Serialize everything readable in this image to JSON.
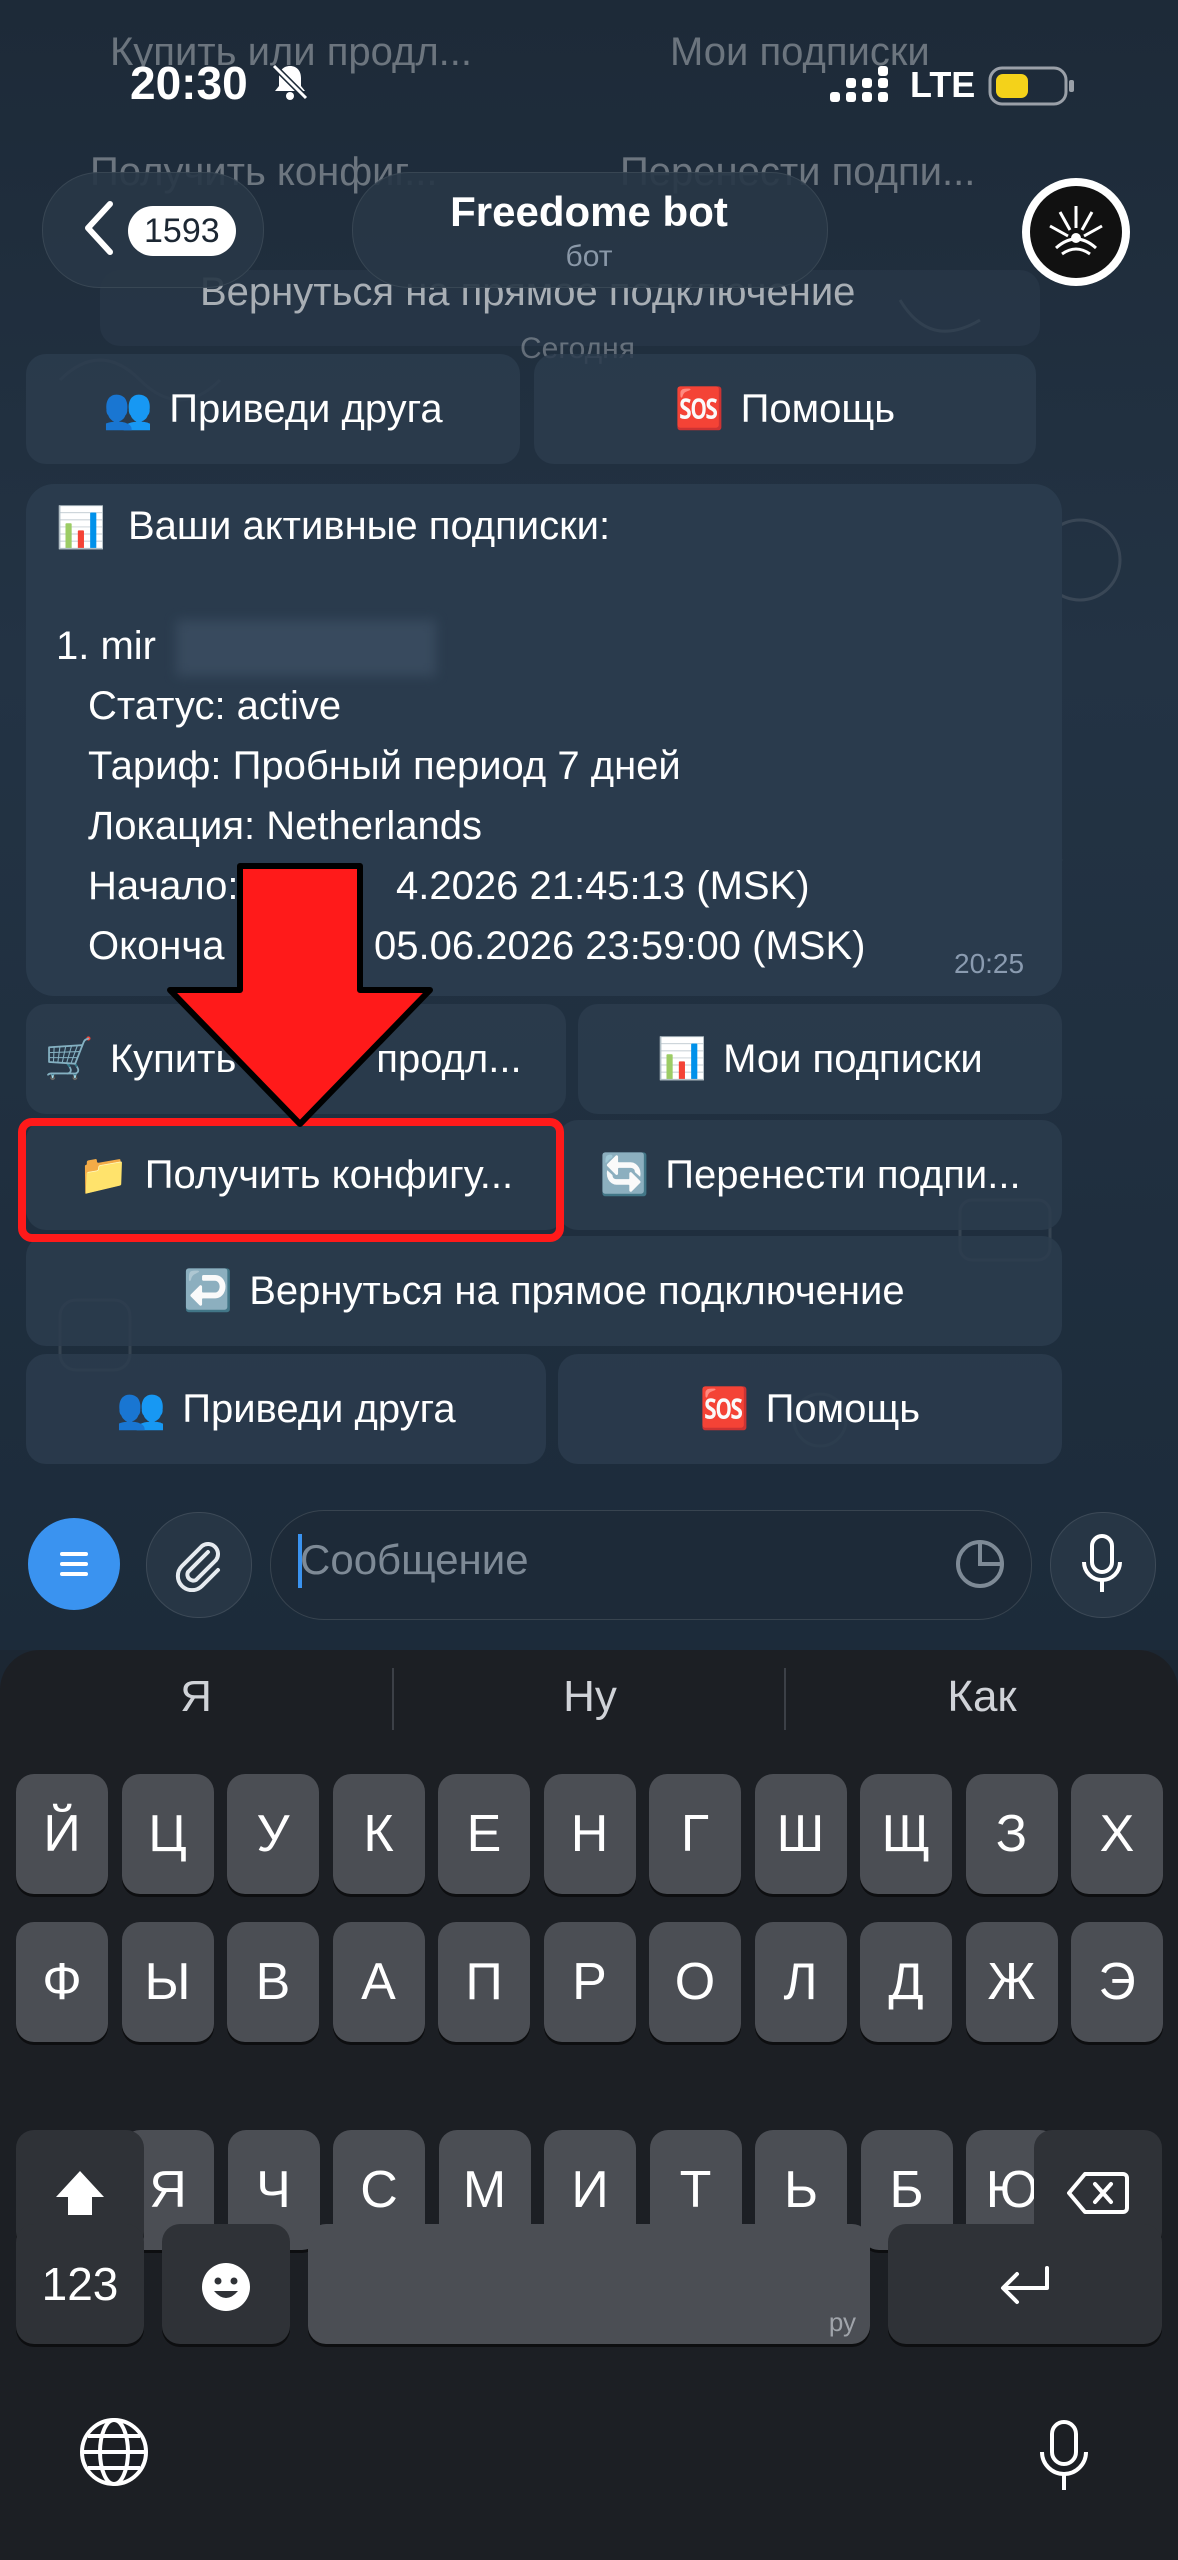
{
  "status_bar": {
    "time": "20:30",
    "network": "LTE"
  },
  "header": {
    "back_count": "1593",
    "title": "Freedome bot",
    "subtitle": "бот"
  },
  "background_faded": {
    "row1_left": "Купить или продл...",
    "row1_right": "Мои подписки",
    "row2_left": "Получить конфиг...",
    "row2_right": "Перенести подпи...",
    "row3": "Вернуться на прямое подключение",
    "date": "Сегодня"
  },
  "top_keyboard": {
    "invite": "Приведи друга",
    "help": "Помощь"
  },
  "message": {
    "header": "Ваши активные подписки:",
    "item_prefix": "1. mir",
    "status": "Статус: active",
    "tariff": "Тариф: Пробный период 7 дней",
    "location": "Локация: Netherlands",
    "start": "Начало: ",
    "start_value": "4.2026 21:45:13 (MSK)",
    "end": "Оконча",
    "end_value": "05.06.2026 23:59:00 (MSK)",
    "time": "20:25"
  },
  "inline_keyboard": {
    "buy": "Купить",
    "buy_tail": "продл...",
    "my_subs": "Мои подписки",
    "get_config": "Получить конфигу...",
    "transfer": "Перенести подпи...",
    "return_direct": "Вернуться на прямое подключение",
    "invite": "Приведи друга",
    "help": "Помощь"
  },
  "emoji": {
    "cart": "🛒",
    "chart": "📊",
    "folder": "📁",
    "sync": "🔄",
    "return": "↩️",
    "people": "👥",
    "sos": "🆘"
  },
  "input": {
    "placeholder": "Сообщение"
  },
  "suggestions": [
    "Я",
    "Ну",
    "Как"
  ],
  "keyboard": {
    "row1": [
      "Й",
      "Ц",
      "У",
      "К",
      "Е",
      "Н",
      "Г",
      "Ш",
      "Щ",
      "З",
      "Х"
    ],
    "row2": [
      "Ф",
      "Ы",
      "В",
      "А",
      "П",
      "Р",
      "О",
      "Л",
      "Д",
      "Ж",
      "Э"
    ],
    "row3": [
      "Я",
      "Ч",
      "С",
      "М",
      "И",
      "Т",
      "Ь",
      "Б",
      "Ю"
    ],
    "numbers": "123",
    "space_lang": "ру"
  },
  "colors": {
    "accent": "#3a93f0",
    "annotation": "#ff1a1a",
    "bubble": "#2a3b4d"
  }
}
